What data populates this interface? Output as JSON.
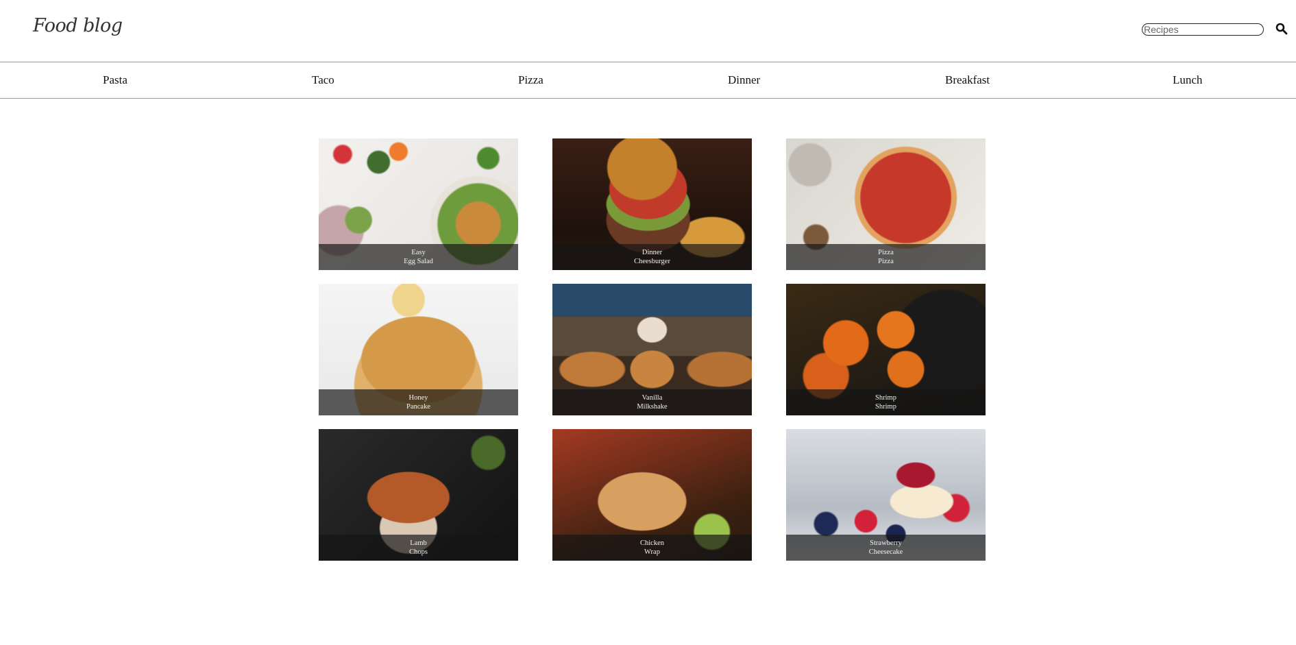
{
  "header": {
    "logo_text": "Food blog",
    "search": {
      "placeholder": "Recipes",
      "value": ""
    },
    "search_icon": "search-icon"
  },
  "nav": {
    "items": [
      {
        "label": "Pasta"
      },
      {
        "label": "Taco"
      },
      {
        "label": "Pizza"
      },
      {
        "label": "Dinner"
      },
      {
        "label": "Breakfast"
      },
      {
        "label": "Lunch"
      }
    ]
  },
  "recipes": [
    {
      "line1": "Easy",
      "line2": "Egg Salad"
    },
    {
      "line1": "Dinner",
      "line2": "Cheesburger"
    },
    {
      "line1": "Pizza",
      "line2": "Pizza"
    },
    {
      "line1": "Honey",
      "line2": "Pancake"
    },
    {
      "line1": "Vanilla",
      "line2": "Milkshake"
    },
    {
      "line1": "Shrimp",
      "line2": "Shrimp"
    },
    {
      "line1": "Lamb",
      "line2": "Chops"
    },
    {
      "line1": "Chicken",
      "line2": "Wrap"
    },
    {
      "line1": "Strawberry",
      "line2": "Cheesecake"
    }
  ]
}
